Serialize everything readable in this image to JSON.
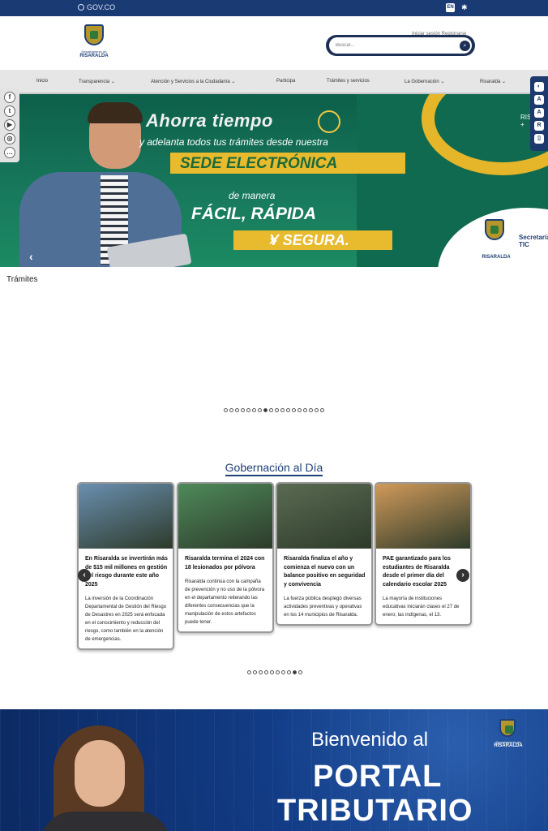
{
  "topbar": {
    "govco_label": "GOV.CO",
    "lang_label": "EN",
    "a11y_glyph": "✱"
  },
  "header": {
    "logo": {
      "subtitle": "Departamento de",
      "name": "RISARALDA"
    },
    "user_links": "Iniciar sesión   Registrarse",
    "search": {
      "placeholder": "Buscar...",
      "value": ""
    }
  },
  "nav": {
    "items": [
      {
        "label": "Inicio"
      },
      {
        "label": "Transparencia"
      },
      {
        "label": "Atención y Servicios a la Ciudadanía"
      },
      {
        "label": "Participa"
      },
      {
        "label": "Trámites y servicios"
      },
      {
        "label": "La Gobernación"
      },
      {
        "label": "Risaralda"
      }
    ]
  },
  "hero": {
    "title": "Ahorra tiempo",
    "subtitle": "y adelanta todos tus trámites desde nuestra",
    "banner": "SEDE ELECTRÓNICA",
    "manera": "de manera",
    "facil": "FÁCIL, RÁPIDA",
    "segura": "Y SEGURA.",
    "logo_name": "RISARALDA",
    "tic": "Secretaría TIC",
    "edge_text": "RIS",
    "edge_plus": "+",
    "prev_glyph": "‹"
  },
  "social": [
    {
      "name": "facebook",
      "glyph": "f"
    },
    {
      "name": "twitter",
      "glyph": "t"
    },
    {
      "name": "youtube",
      "glyph": "▶"
    },
    {
      "name": "instagram",
      "glyph": "◎"
    },
    {
      "name": "chat",
      "glyph": "…"
    }
  ],
  "tools": [
    {
      "name": "contrast",
      "glyph": "◐"
    },
    {
      "name": "zoom-in",
      "glyph": "A"
    },
    {
      "name": "zoom-out",
      "glyph": "A"
    },
    {
      "name": "center-relevo",
      "glyph": "R"
    },
    {
      "name": "doc",
      "glyph": "▯"
    }
  ],
  "tramites": {
    "title": "Trámites",
    "dots_total": 18,
    "dots_active": 7
  },
  "news_section": {
    "title": "Gobernación al Día",
    "dots_total": 10,
    "dots_active": 8,
    "prev_glyph": "‹",
    "next_glyph": "›",
    "cards": [
      {
        "title": "En Risaralda se invertirán más de $15 mil millones en gestión del riesgo durante este año 2025",
        "text": "La inversión de la Coordinación Departamental de Gestión del Riesgo de Desastres en 2025 será enfocada en el conocimiento y reducción del riesgo, como también en la atención de emergencias.",
        "img_color": "#6a8fb0"
      },
      {
        "title": "Risaralda termina el 2024 con 18 lesionados por pólvora",
        "text": "Risaralda continúa con la campaña de prevención y no uso de la pólvora en el departamento reiterando las diferentes consecuencias que la manipulación de estos artefactos puede tener.",
        "img_color": "#4e8a5a"
      },
      {
        "title": "Risaralda finaliza el año y comienza el nuevo con un balance positivo en seguridad y convivencia",
        "text": "La fuerza pública desplegó diversas actividades preventivas y operativas en los 14 municipios de Risaralda.",
        "img_color": "#5a6b52"
      },
      {
        "title": "PAE garantizado para los estudiantes de Risaralda desde el primer día del calendario escolar 2025",
        "text": "La mayoría de instituciones educativas iniciarán clases el 27 de enero; las indígenas, el 13.",
        "img_color": "#d09a5a"
      }
    ]
  },
  "portal": {
    "welcome": "Bienvenido al",
    "line1": "PORTAL",
    "line2": "TRIBUTARIO",
    "logo_subtitle": "Departamento de",
    "logo_name": "RISARALDA"
  }
}
